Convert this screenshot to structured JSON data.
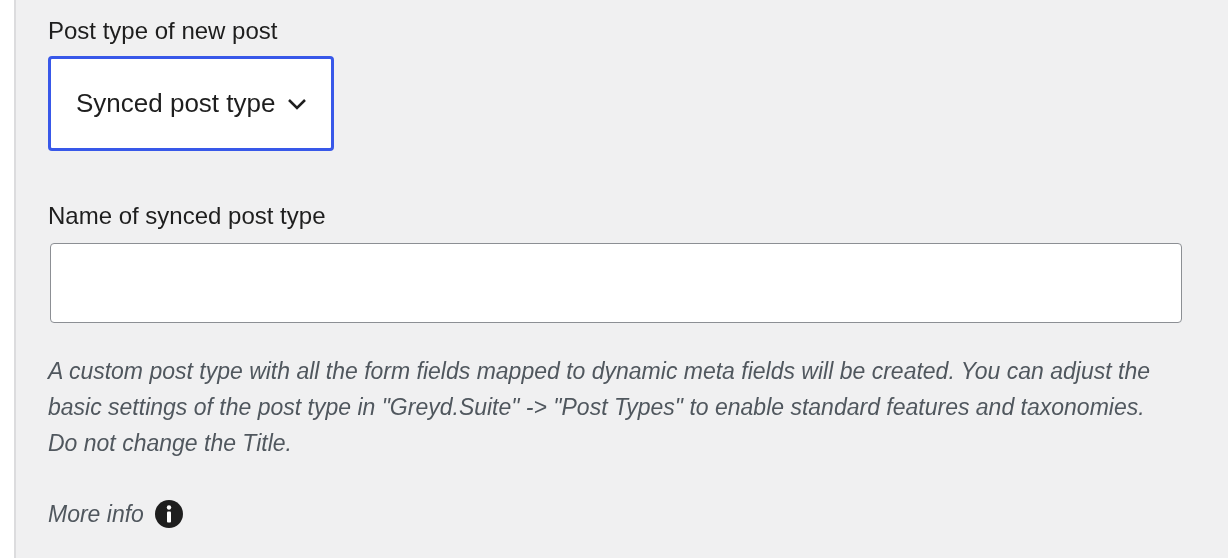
{
  "fields": [
    {
      "kind": "select",
      "label": "Post type of new post",
      "value": "Synced post type",
      "focused": true
    },
    {
      "kind": "text",
      "label": "Name of synced post type",
      "focused": false
    }
  ],
  "help_text": "A custom post type with all the form fields mapped to dynamic meta fields will be created. You can adjust the basic settings of the post type in \"Greyd.Suite\" -> \"Post Types\" to enable standard features and taxonomies. Do not change the Title.",
  "more_info": {
    "label": "More info"
  }
}
